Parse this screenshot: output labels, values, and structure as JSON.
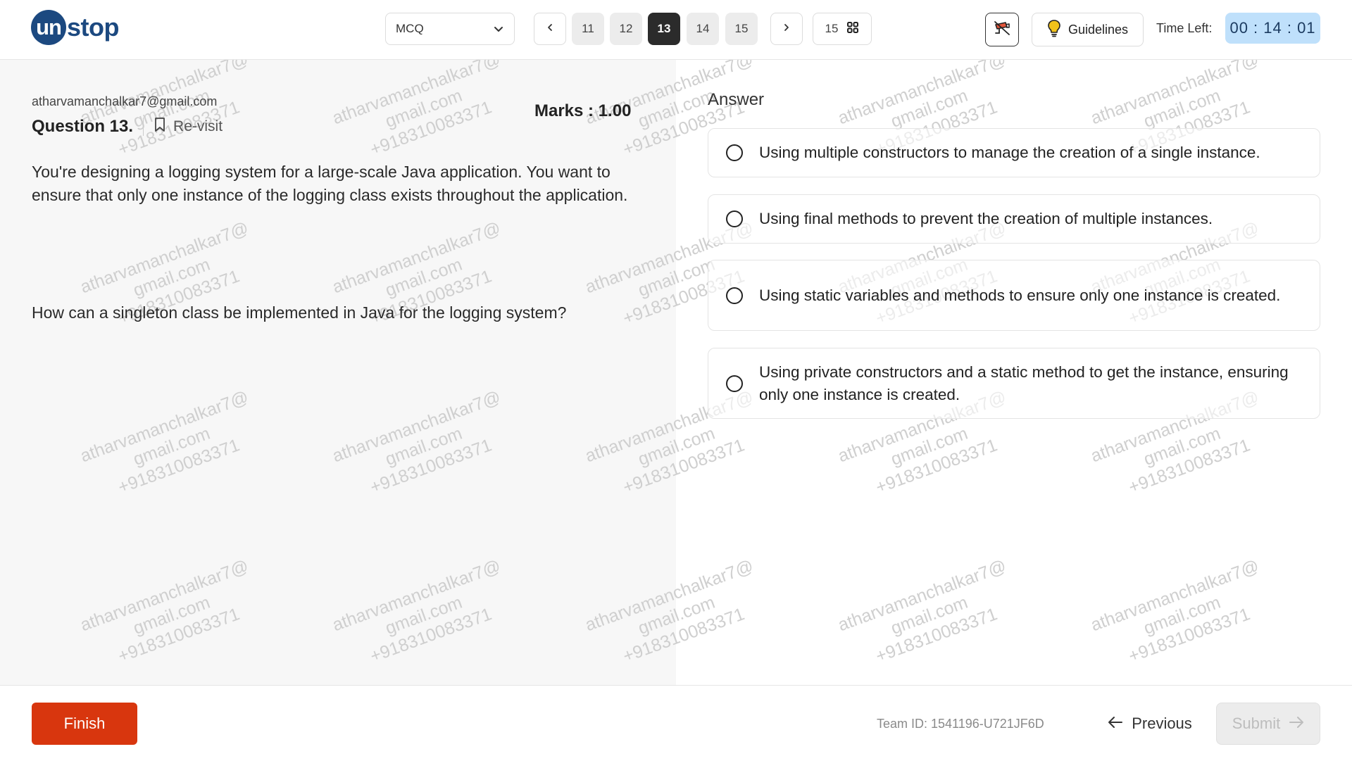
{
  "header": {
    "logo_prefix": "un",
    "logo_suffix": "stop",
    "question_type": "MCQ",
    "pages": [
      "11",
      "12",
      "13",
      "14",
      "15"
    ],
    "current_page": "13",
    "total_questions": "15",
    "guidelines_label": "Guidelines",
    "time_left_label": "Time Left:",
    "timer": "00 : 14 : 01"
  },
  "question": {
    "user_email": "atharvamanchalkar7@gmail.com",
    "title": "Question 13.",
    "revisit_label": "Re-visit",
    "marks": "Marks : 1.00",
    "body": "You're designing a logging system for a large-scale Java application. You want to ensure that only one instance of the logging class exists throughout the application.",
    "prompt": "How can a singleton class be implemented in Java for the logging system?"
  },
  "answer": {
    "label": "Answer",
    "options": [
      "Using multiple constructors to manage the creation of a single instance.",
      "Using final methods to prevent the creation of multiple instances.",
      "Using static variables and methods to ensure only one instance is created.",
      "Using private constructors and a static method to get the instance, ensuring only one instance is created."
    ]
  },
  "watermark": {
    "line1": "atharvamanchalkar7@",
    "line2": "gmail.com",
    "line3": "+918310083371"
  },
  "footer": {
    "finish_label": "Finish",
    "team_id": "Team ID: 1541196-U721JF6D",
    "previous_label": "Previous",
    "submit_label": "Submit"
  },
  "colors": {
    "brand": "#1c4980",
    "finish": "#d8360e",
    "timer_bg": "#bfe0fb",
    "active_page": "#2b2b2b"
  }
}
